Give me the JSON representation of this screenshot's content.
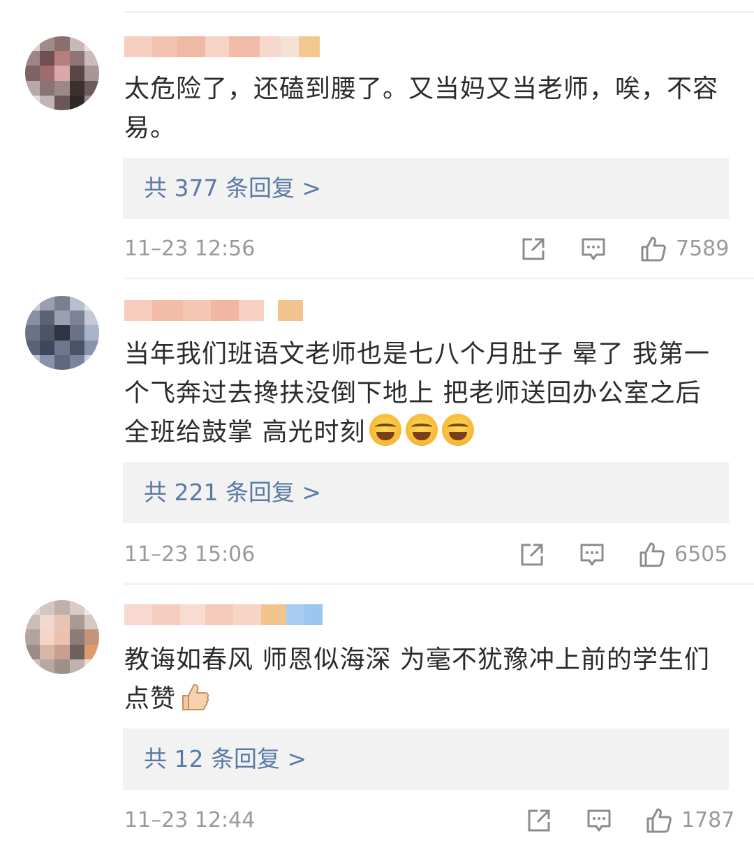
{
  "comments": [
    {
      "text": "太危险了，还磕到腰了。又当妈又当老师，唉，不容易。",
      "reply_link": "共 377 条回复 >",
      "time": "11–23 12:56",
      "likes": "7589",
      "icons": [
        "share-icon",
        "comment-icon",
        "like-icon"
      ]
    },
    {
      "text": "当年我们班语文老师也是七八个月肚子 晕了 我第一个飞奔过去搀扶没倒下地上 把老师送回办公室之后 全班给鼓掌 高光时刻",
      "emojis": [
        "laugh-cry-emoji",
        "laugh-cry-emoji",
        "laugh-cry-emoji"
      ],
      "reply_link": "共 221 条回复 >",
      "time": "11–23 15:06",
      "likes": "6505",
      "icons": [
        "share-icon",
        "comment-icon",
        "like-icon"
      ]
    },
    {
      "text": "教诲如春风 师恩似海深 为毫不犹豫冲上前的学生们点赞",
      "emojis": [
        "thumbs-up-emoji"
      ],
      "reply_link": "共 12 条回复 >",
      "time": "11–23 12:44",
      "likes": "1787",
      "icons": [
        "share-icon",
        "comment-icon",
        "like-icon"
      ]
    }
  ],
  "colors": {
    "reply_link": "#5a7aa6",
    "reply_background": "#f2f2f2",
    "meta_text": "#9a9a9a",
    "body_text": "#2b2b2b"
  }
}
